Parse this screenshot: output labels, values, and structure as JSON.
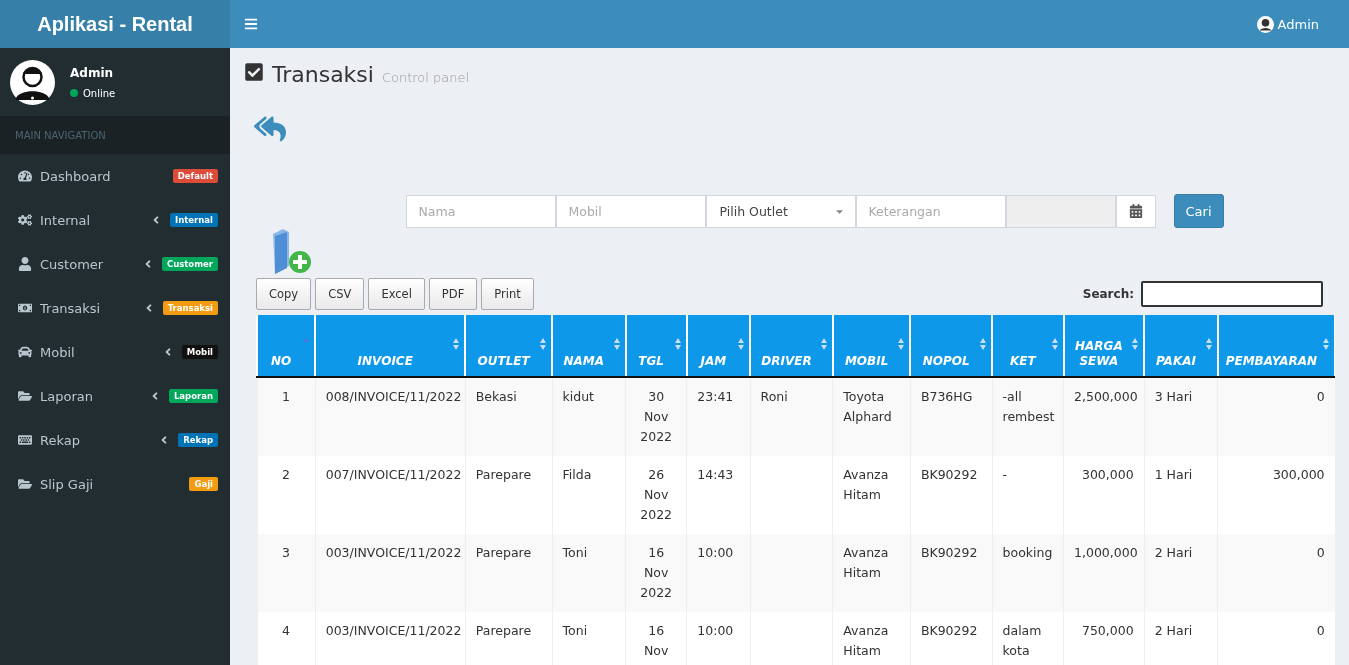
{
  "brand": "Aplikasi - Rental",
  "topbar": {
    "user": "Admin"
  },
  "user_panel": {
    "name": "Admin",
    "status": "Online",
    "color": "#00a65a"
  },
  "nav_header": "MAIN NAVIGATION",
  "sidebar": {
    "items": [
      {
        "label": "Dashboard",
        "badge": "Default",
        "color": "#dd4b39",
        "has_caret": false
      },
      {
        "label": "Internal",
        "badge": "Internal",
        "color": "#0073b7",
        "has_caret": true
      },
      {
        "label": "Customer",
        "badge": "Customer",
        "color": "#00a65a",
        "has_caret": true
      },
      {
        "label": "Transaksi",
        "badge": "Transaksi",
        "color": "#f39c12",
        "has_caret": true
      },
      {
        "label": "Mobil",
        "badge": "Mobil",
        "color": "#111111",
        "has_caret": true
      },
      {
        "label": "Laporan",
        "badge": "Laporan",
        "color": "#00a65a",
        "has_caret": true
      },
      {
        "label": "Rekap",
        "badge": "Rekap",
        "color": "#0073b7",
        "has_caret": true
      },
      {
        "label": "Slip Gaji",
        "badge": "Gaji",
        "color": "#f39c12",
        "has_caret": false
      }
    ]
  },
  "page": {
    "title": "Transaksi",
    "subtitle": "Control panel"
  },
  "filters": {
    "nama": {
      "placeholder": "Nama"
    },
    "mobil": {
      "placeholder": "Mobil"
    },
    "outlet": {
      "value": "Pilih Outlet"
    },
    "keterangan": {
      "placeholder": "Keterangan"
    },
    "submit": "Cari"
  },
  "export_buttons": [
    "Copy",
    "CSV",
    "Excel",
    "PDF",
    "Print"
  ],
  "search": {
    "label": "Search:"
  },
  "table": {
    "columns": [
      {
        "label": "NO",
        "sorted": true
      },
      {
        "label": "INVOICE",
        "sorted": false
      },
      {
        "label": "OUTLET",
        "sorted": false
      },
      {
        "label": "NAMA",
        "sorted": false
      },
      {
        "label": "TGL",
        "sorted": false
      },
      {
        "label": "JAM",
        "sorted": false
      },
      {
        "label": "DRIVER",
        "sorted": false
      },
      {
        "label": "MOBIL",
        "sorted": false
      },
      {
        "label": "NOPOL",
        "sorted": false
      },
      {
        "label": "KET",
        "sorted": false
      },
      {
        "label": "HARGA SEWA",
        "sorted": false
      },
      {
        "label": "PAKAI",
        "sorted": false
      },
      {
        "label": "PEMBAYARAN",
        "sorted": false
      }
    ],
    "rows": [
      [
        "1",
        "008/INVOICE/11/2022",
        "Bekasi",
        "kidut",
        "30 Nov 2022",
        "23:41",
        "Roni",
        "Toyota Alphard",
        "B736HG",
        "-all rembest",
        "2,500,000",
        "3 Hari",
        "0"
      ],
      [
        "2",
        "007/INVOICE/11/2022",
        "Parepare",
        "Filda",
        "26 Nov 2022",
        "14:43",
        "",
        "Avanza Hitam",
        "BK90292",
        "-",
        "300,000",
        "1 Hari",
        "300,000"
      ],
      [
        "3",
        "003/INVOICE/11/2022",
        "Parepare",
        "Toni",
        "16 Nov 2022",
        "10:00",
        "",
        "Avanza Hitam",
        "BK90292",
        "booking",
        "1,000,000",
        "2 Hari",
        "0"
      ],
      [
        "4",
        "003/INVOICE/11/2022",
        "Parepare",
        "Toni",
        "16 Nov",
        "10:00",
        "",
        "Avanza Hitam",
        "BK90292",
        "dalam kota",
        "750,000",
        "2 Hari",
        "0"
      ]
    ]
  }
}
